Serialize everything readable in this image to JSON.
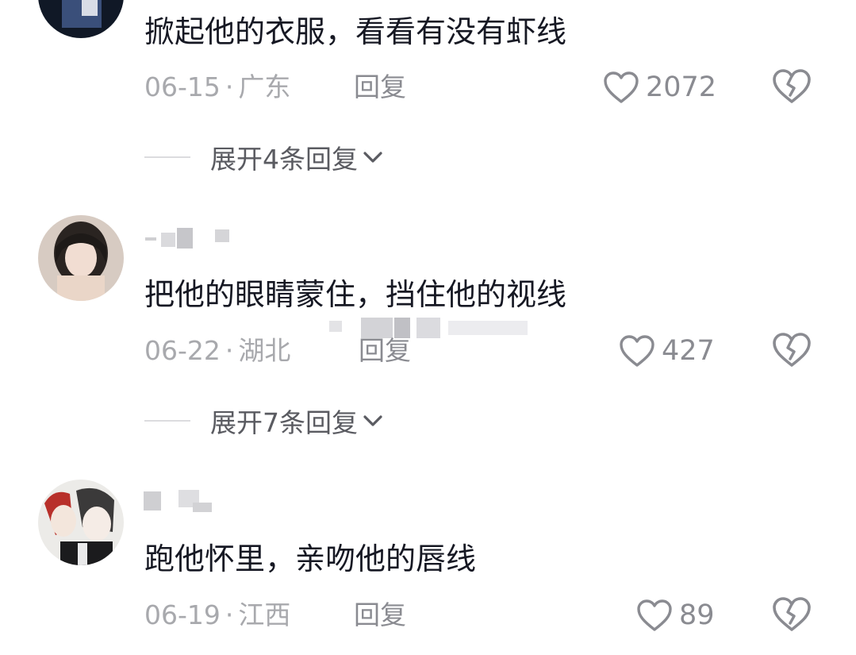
{
  "comments": [
    {
      "text": "掀起他的衣服，看看有没有虾线",
      "date": "06-15",
      "location": "广东",
      "reply_label": "回复",
      "likes": "2072",
      "expand_label": "展开4条回复"
    },
    {
      "text": "把他的眼睛蒙住，挡住他的视线",
      "date": "06-22",
      "location": "湖北",
      "reply_label": "回复",
      "likes": "427",
      "expand_label": "展开7条回复"
    },
    {
      "text": "跑他怀里，亲吻他的唇线",
      "date": "06-19",
      "location": "江西",
      "reply_label": "回复",
      "likes": "89"
    }
  ],
  "separator": "·",
  "colors": {
    "text": "#161823",
    "meta": "#a8a9ad",
    "action": "#8a8b91",
    "expand": "#5a5b61"
  },
  "icons": {
    "like": "heart-outline-icon",
    "dislike": "broken-heart-icon",
    "expand": "chevron-down-icon"
  }
}
